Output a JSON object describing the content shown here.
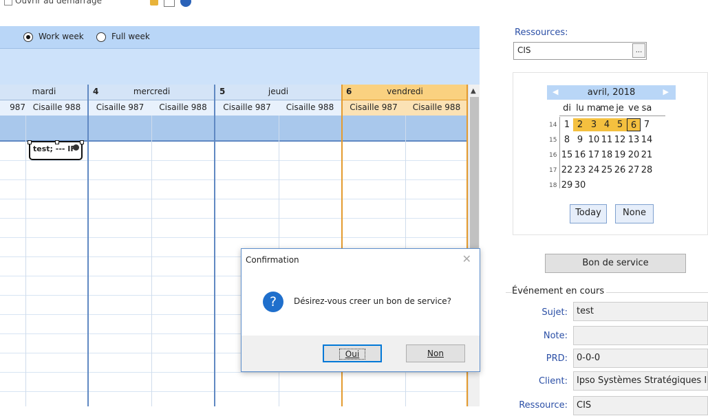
{
  "toolbar": {
    "clipped_label": "Ouvrir au démarrage"
  },
  "view_options": {
    "work_week": "Work week",
    "full_week": "Full week",
    "selected": "Work week"
  },
  "calendar": {
    "days": [
      {
        "num": "",
        "name": "mardi",
        "today": false
      },
      {
        "num": "4",
        "name": "mercredi",
        "today": false
      },
      {
        "num": "5",
        "name": "jeudi",
        "today": false
      },
      {
        "num": "6",
        "name": "vendredi",
        "today": true
      }
    ],
    "resources": [
      "987",
      "Cisaille 988",
      "Cisaille 987",
      "Cisaille 988",
      "Cisaille 987",
      "Cisaille 988",
      "Cisaille 987",
      "Cisaille 988"
    ],
    "appointment": {
      "text": "test; --- IF"
    }
  },
  "resources_panel": {
    "label": "Ressources:",
    "value": "CIS",
    "browse_label": "..."
  },
  "mini_calendar": {
    "month": "avril, 2018",
    "dow": [
      "di",
      "lu",
      "ma",
      "me",
      "je",
      "ve",
      "sa"
    ],
    "weeks": [
      {
        "wk": "14",
        "days": [
          "1",
          "2",
          "3",
          "4",
          "5",
          "6",
          "7"
        ]
      },
      {
        "wk": "15",
        "days": [
          "8",
          "9",
          "10",
          "11",
          "12",
          "13",
          "14"
        ]
      },
      {
        "wk": "16",
        "days": [
          "15",
          "16",
          "17",
          "18",
          "19",
          "20",
          "21"
        ]
      },
      {
        "wk": "17",
        "days": [
          "22",
          "23",
          "24",
          "25",
          "26",
          "27",
          "28"
        ]
      },
      {
        "wk": "18",
        "days": [
          "29",
          "30"
        ]
      }
    ],
    "selected_range": [
      "2",
      "3",
      "4",
      "5"
    ],
    "current_day": "6",
    "today_label": "Today",
    "none_label": "None",
    "highlight_color": "#f4c03f"
  },
  "bon_button": "Bon de service",
  "event": {
    "group_title": "Événement en cours",
    "subject_label": "Sujet:",
    "subject_value": "test",
    "note_label": "Note:",
    "note_value": "",
    "prd_label": "PRD:",
    "prd_value": "0-0-0",
    "client_label": "Client:",
    "client_value": "Ipso Systèmes Stratégiques Inc",
    "resource_label": "Ressource:",
    "resource_value": "CIS"
  },
  "dialog": {
    "title": "Confirmation",
    "icon": "question-icon",
    "message": "Désirez-vous creer un bon de service?",
    "yes": "Oui",
    "no": "Non"
  },
  "colors": {
    "accent_blue": "#b9d6f7",
    "today_orange": "#e49b2e",
    "link_blue": "#2b4fa6"
  }
}
